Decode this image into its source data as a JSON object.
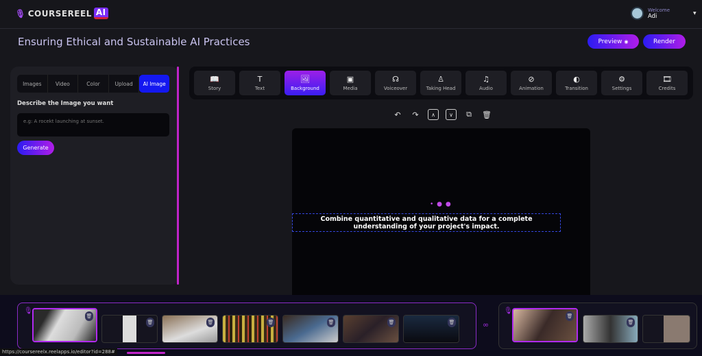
{
  "header": {
    "logo_text": "COURSEREEL",
    "logo_badge": "AI",
    "welcome": "Welcome",
    "user_name": "Adi"
  },
  "page_title": "Ensuring Ethical and Sustainable AI Practices",
  "buttons": {
    "preview": "Preview",
    "render": "Render",
    "generate": "Generate"
  },
  "left_panel": {
    "tabs": [
      "Images",
      "Video",
      "Color",
      "Upload",
      "AI Image"
    ],
    "active_tab": "AI Image",
    "label": "Describe the Image you want",
    "placeholder": "e.g: A rocekt launching at sunset."
  },
  "toolbar": [
    {
      "label": "Story",
      "icon": "book-icon"
    },
    {
      "label": "Text",
      "icon": "text-icon"
    },
    {
      "label": "Background",
      "icon": "image-stack-icon"
    },
    {
      "label": "Media",
      "icon": "media-icon"
    },
    {
      "label": "Voiceover",
      "icon": "voiceover-icon"
    },
    {
      "label": "Taking Head",
      "icon": "person-icon"
    },
    {
      "label": "Audio",
      "icon": "music-icon"
    },
    {
      "label": "Animation",
      "icon": "animation-icon"
    },
    {
      "label": "Transition",
      "icon": "transition-icon"
    },
    {
      "label": "Settings",
      "icon": "settings-icon"
    },
    {
      "label": "Credits",
      "icon": "film-icon"
    }
  ],
  "active_tool": "Background",
  "canvas": {
    "caption": "Combine quantitative and qualitative data for a complete understanding of your project's impact."
  },
  "status_url": "https://coursereelx.reelapps.io/editor?id=288#",
  "colors": {
    "accent_blue": "#1418f0",
    "accent_purple": "#b01de8",
    "timeline_border": "#8a2bc6"
  }
}
